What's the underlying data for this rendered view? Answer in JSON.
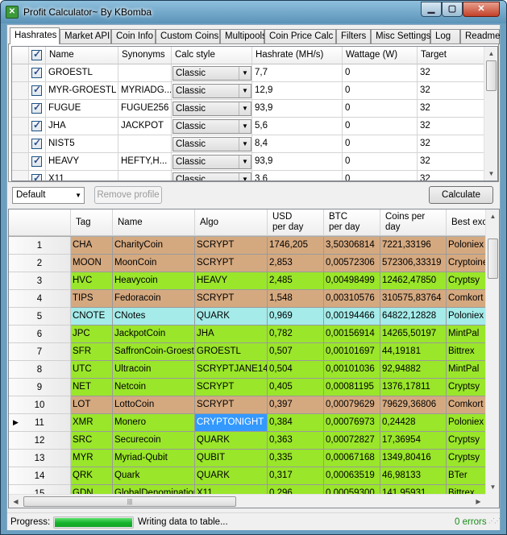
{
  "window": {
    "title": "Profit Calculator~ By KBomba",
    "controls": {
      "minimize": "▁",
      "maximize": "▢",
      "close": "✕"
    }
  },
  "tabs": [
    {
      "label": "Hashrates",
      "active": true
    },
    {
      "label": "Market API"
    },
    {
      "label": "Coin Info"
    },
    {
      "label": "Custom Coins"
    },
    {
      "label": "Multipools"
    },
    {
      "label": "Coin Price Calc"
    },
    {
      "label": "Filters"
    },
    {
      "label": "Misc Settings"
    },
    {
      "label": "Log"
    },
    {
      "label": "Readme"
    }
  ],
  "hashrates": {
    "columns": [
      "Name",
      "Synonyms",
      "Calc style",
      "Hashrate (MH/s)",
      "Wattage (W)",
      "Target"
    ],
    "rows": [
      {
        "checked": true,
        "name": "GROESTL",
        "synonyms": "",
        "calc_style": "Classic",
        "hashrate": "7,7",
        "wattage": "0",
        "target": "32"
      },
      {
        "checked": true,
        "name": "MYR-GROESTL",
        "synonyms": "MYRIADG...",
        "calc_style": "Classic",
        "hashrate": "12,9",
        "wattage": "0",
        "target": "32"
      },
      {
        "checked": true,
        "name": "FUGUE",
        "synonyms": "FUGUE256",
        "calc_style": "Classic",
        "hashrate": "93,9",
        "wattage": "0",
        "target": "32"
      },
      {
        "checked": true,
        "name": "JHA",
        "synonyms": "JACKPOT",
        "calc_style": "Classic",
        "hashrate": "5,6",
        "wattage": "0",
        "target": "32"
      },
      {
        "checked": true,
        "name": "NIST5",
        "synonyms": "",
        "calc_style": "Classic",
        "hashrate": "8,4",
        "wattage": "0",
        "target": "32"
      },
      {
        "checked": true,
        "name": "HEAVY",
        "synonyms": "HEFTY,H...",
        "calc_style": "Classic",
        "hashrate": "93,9",
        "wattage": "0",
        "target": "32"
      },
      {
        "checked": true,
        "name": "X11",
        "synonyms": "",
        "calc_style": "Classic",
        "hashrate": "3,6",
        "wattage": "0",
        "target": "32"
      }
    ]
  },
  "toolbar": {
    "profile": "Default",
    "remove_profile": "Remove profile",
    "calculate": "Calculate"
  },
  "results": {
    "columns": [
      "Tag",
      "Name",
      "Algo",
      "USD\nper day",
      "BTC\nper day",
      "Coins per\nday",
      "Best exch"
    ],
    "colors": {
      "scrypt": "#d5a980",
      "green": "#9ae62a",
      "quark_cyan": "#a4ebe9",
      "selected": "#3399ff"
    },
    "rows": [
      {
        "n": "1",
        "tag": "CHA",
        "name": "CharityCoin",
        "algo": "SCRYPT",
        "usd": "1746,205",
        "btc": "3,50306814",
        "coins": "7221,33196",
        "exch": "Poloniex",
        "color": "#d5a980"
      },
      {
        "n": "2",
        "tag": "MOON",
        "name": "MoonCoin",
        "algo": "SCRYPT",
        "usd": "2,853",
        "btc": "0,00572306",
        "coins": "572306,33319",
        "exch": "Cryptoine",
        "color": "#d5a980"
      },
      {
        "n": "3",
        "tag": "HVC",
        "name": "Heavycoin",
        "algo": "HEAVY",
        "usd": "2,485",
        "btc": "0,00498499",
        "coins": "12462,47850",
        "exch": "Cryptsy",
        "color": "#9ae62a"
      },
      {
        "n": "4",
        "tag": "TIPS",
        "name": "Fedoracoin",
        "algo": "SCRYPT",
        "usd": "1,548",
        "btc": "0,00310576",
        "coins": "310575,83764",
        "exch": "Comkort",
        "color": "#d5a980"
      },
      {
        "n": "5",
        "tag": "CNOTE",
        "name": "CNotes",
        "algo": "QUARK",
        "usd": "0,969",
        "btc": "0,00194466",
        "coins": "64822,12828",
        "exch": "Poloniex",
        "color": "#a4ebe9"
      },
      {
        "n": "6",
        "tag": "JPC",
        "name": "JackpotCoin",
        "algo": "JHA",
        "usd": "0,782",
        "btc": "0,00156914",
        "coins": "14265,50197",
        "exch": "MintPal",
        "color": "#9ae62a"
      },
      {
        "n": "7",
        "tag": "SFR",
        "name": "SaffronCoin-Groestl",
        "algo": "GROESTL",
        "usd": "0,507",
        "btc": "0,00101697",
        "coins": "44,19181",
        "exch": "Bittrex",
        "color": "#9ae62a"
      },
      {
        "n": "8",
        "tag": "UTC",
        "name": "Ultracoin",
        "algo": "SCRYPTJANE14",
        "usd": "0,504",
        "btc": "0,00101036",
        "coins": "92,94882",
        "exch": "MintPal",
        "color": "#9ae62a"
      },
      {
        "n": "9",
        "tag": "NET",
        "name": "Netcoin",
        "algo": "SCRYPT",
        "usd": "0,405",
        "btc": "0,00081195",
        "coins": "1376,17811",
        "exch": "Cryptsy",
        "color": "#9ae62a"
      },
      {
        "n": "10",
        "tag": "LOT",
        "name": "LottoCoin",
        "algo": "SCRYPT",
        "usd": "0,397",
        "btc": "0,00079629",
        "coins": "79629,36806",
        "exch": "Comkort",
        "color": "#d5a980"
      },
      {
        "n": "11",
        "tag": "XMR",
        "name": "Monero",
        "algo": "CRYPTONIGHT",
        "usd": "0,384",
        "btc": "0,00076973",
        "coins": "0,24428",
        "exch": "Poloniex",
        "color": "#9ae62a",
        "current": true
      },
      {
        "n": "12",
        "tag": "SRC",
        "name": "Securecoin",
        "algo": "QUARK",
        "usd": "0,363",
        "btc": "0,00072827",
        "coins": "17,36954",
        "exch": "Cryptsy",
        "color": "#9ae62a"
      },
      {
        "n": "13",
        "tag": "MYR",
        "name": "Myriad-Qubit",
        "algo": "QUBIT",
        "usd": "0,335",
        "btc": "0,00067168",
        "coins": "1349,80416",
        "exch": "Cryptsy",
        "color": "#9ae62a"
      },
      {
        "n": "14",
        "tag": "QRK",
        "name": "Quark",
        "algo": "QUARK",
        "usd": "0,317",
        "btc": "0,00063519",
        "coins": "46,98133",
        "exch": "BTer",
        "color": "#9ae62a"
      },
      {
        "n": "15",
        "tag": "GDN",
        "name": "GlobalDenomination",
        "algo": "X11",
        "usd": "0,296",
        "btc": "0,00059300",
        "coins": "141,95931",
        "exch": "Bittrex",
        "color": "#9ae62a"
      }
    ]
  },
  "status": {
    "label": "Progress:",
    "progress": 1.0,
    "message": "Writing data to table...",
    "errors": "0 errors"
  }
}
